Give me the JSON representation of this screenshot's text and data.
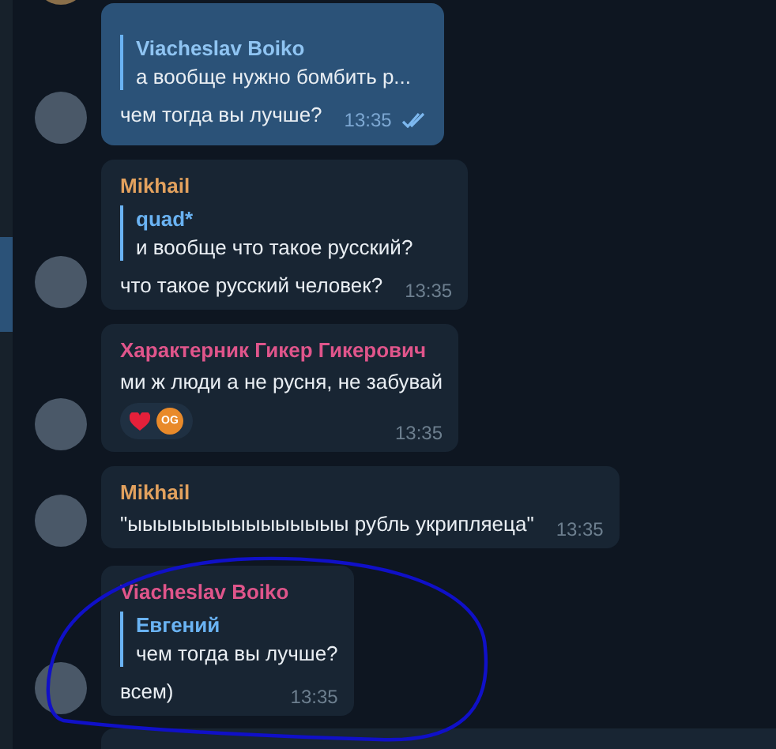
{
  "messages": [
    {
      "kind": "outgoing",
      "reply": {
        "author": "Viacheslav Boiko",
        "text": "а вообще нужно бомбить р..."
      },
      "text": "чем тогда вы лучше?",
      "time": "13:35",
      "read": true
    },
    {
      "kind": "incoming",
      "sender": "Mikhail",
      "color": "#e2a15e",
      "reply": {
        "author": "quad*",
        "text": "и вообще что такое русский?"
      },
      "text": "что такое русский человек?",
      "time": "13:35"
    },
    {
      "kind": "incoming",
      "sender": "Характерник Гикер Гикерович",
      "color": "#e0558b",
      "text": "ми ж люди а не русня, не забувай",
      "time": "13:35",
      "reactions": [
        {
          "kind": "heart"
        },
        {
          "kind": "user",
          "label": "OG"
        }
      ]
    },
    {
      "kind": "incoming",
      "sender": "Mikhail",
      "color": "#e2a15e",
      "text": "\"ыыыыыыыыыыыыыыы рубль укрипляеца\"",
      "time": "13:35"
    },
    {
      "kind": "incoming",
      "sender": "Viacheslav Boiko",
      "color": "#e0558b",
      "reply": {
        "author": "Евгений",
        "text": "чем тогда вы лучше?"
      },
      "text": "всем)",
      "time": "13:35"
    }
  ]
}
